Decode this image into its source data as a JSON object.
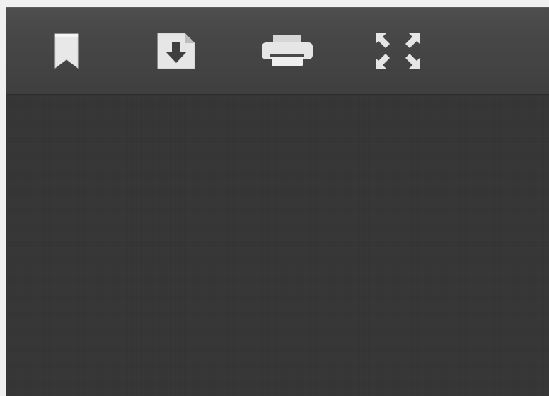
{
  "toolbar": {
    "buttons": [
      {
        "icon": "bookmark-icon",
        "action": "bookmark"
      },
      {
        "icon": "download-icon",
        "action": "download"
      },
      {
        "icon": "print-icon",
        "action": "print"
      },
      {
        "icon": "fullscreen-icon",
        "action": "fullscreen"
      }
    ]
  },
  "colors": {
    "toolbar_bg": "#474747",
    "content_bg": "#363636",
    "icon": "#e6e6e6"
  }
}
